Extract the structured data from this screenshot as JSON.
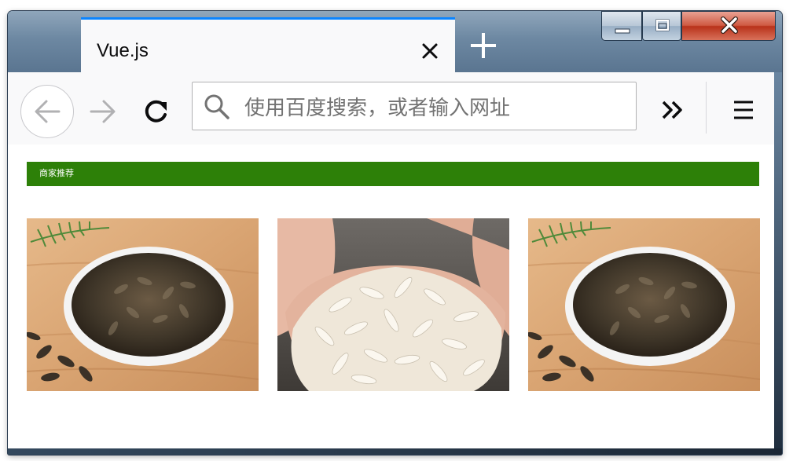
{
  "browser": {
    "tab": {
      "title": "Vue.js",
      "close_icon": "close-icon"
    },
    "new_tab_icon": "plus-icon",
    "window_controls": [
      "minimize-icon",
      "maximize-icon",
      "close-window-icon"
    ],
    "nav": {
      "back_icon": "arrow-left-icon",
      "forward_icon": "arrow-right-icon",
      "reload_icon": "reload-icon",
      "search_icon": "search-icon",
      "url_placeholder": "使用百度搜索，或者输入网址",
      "overflow_icon": "chevrons-right-icon",
      "menu_icon": "hamburger-menu-icon"
    },
    "accent_color": "#0a84ff"
  },
  "page": {
    "banner": {
      "text": "商家推荐",
      "color": "#2d8008"
    },
    "products": [
      {
        "image": "sunflower-seeds-bowl-image"
      },
      {
        "image": "shelled-seeds-in-hands-image"
      },
      {
        "image": "sunflower-seeds-bowl-image"
      }
    ]
  }
}
